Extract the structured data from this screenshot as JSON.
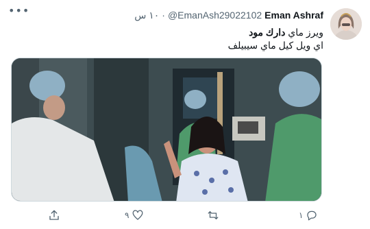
{
  "tweet": {
    "display_name": "Eman Ashraf",
    "handle": "@EmanAsh29022102",
    "separator": "·",
    "time": "١٠ س",
    "text_line1_prefix": "ويرز ماي ",
    "text_line1_bold": "دارك مود",
    "text_line2": "اي ويل كيل ماي سيبيلف"
  },
  "actions": {
    "reply_count": "١",
    "like_count": "٩"
  },
  "icons": {
    "more": "more-horizontal-icon",
    "reply": "reply-icon",
    "retweet": "retweet-icon",
    "like": "heart-icon",
    "share": "share-icon"
  },
  "colors": {
    "text_primary": "#0f1419",
    "text_secondary": "#536471",
    "border": "#cfd9de"
  }
}
